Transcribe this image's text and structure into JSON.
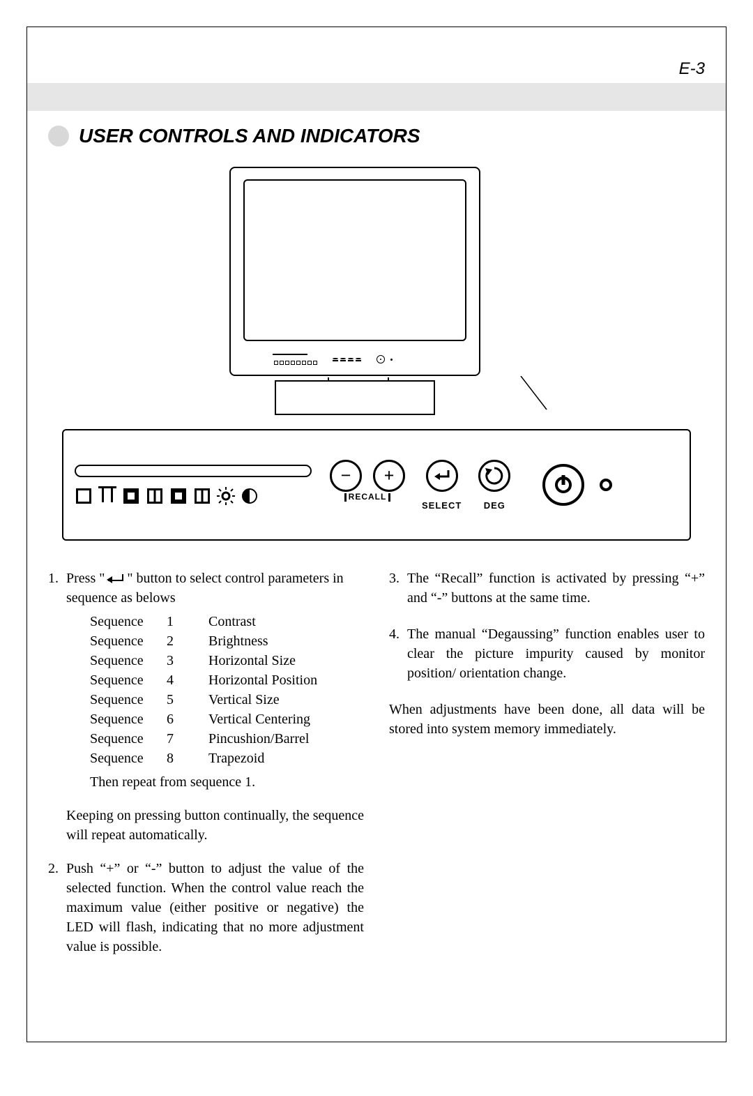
{
  "page_number": "E-3",
  "title": "USER CONTROLS AND INDICATORS",
  "panel": {
    "recall_label": "RECALL",
    "select_label": "SELECT",
    "deg_label": "DEG",
    "minus": "−",
    "plus": "+"
  },
  "icons": {
    "hsize": "h-size-icon",
    "vsize": "v-size-icon",
    "hpos": "h-pos-icon",
    "vpos": "v-pos-icon",
    "pincushion": "pincushion-icon",
    "trapezoid": "trapezoid-icon",
    "brightness": "brightness-icon",
    "contrast": "contrast-icon"
  },
  "left": {
    "item1_lead": "Press \" ",
    "item1_tail": " \" button to select control parameters in sequence as belows",
    "seq_label": "Sequence",
    "sequences": [
      {
        "n": "1",
        "name": "Contrast"
      },
      {
        "n": "2",
        "name": "Brightness"
      },
      {
        "n": "3",
        "name": "Horizontal Size"
      },
      {
        "n": "4",
        "name": "Horizontal Position"
      },
      {
        "n": "5",
        "name": "Vertical Size"
      },
      {
        "n": "6",
        "name": "Vertical Centering"
      },
      {
        "n": "7",
        "name": "Pincushion/Barrel"
      },
      {
        "n": "8",
        "name": "Trapezoid"
      }
    ],
    "then_repeat": "Then repeat from sequence 1.",
    "keeping": "Keeping on pressing button continually, the sequence will repeat automatically.",
    "item2": "Push “+” or “-” button to adjust the value of the selected function. When the control value reach the maximum value (either positive or negative) the LED will flash, indicating that no more adjustment value is possible."
  },
  "right": {
    "item3": "The “Recall” function is activated by pressing “+” and “-” buttons at the same time.",
    "item4": "The manual “Degaussing” function enables user to clear the picture impurity caused by monitor position/ orientation change.",
    "footer": "When adjustments have been done, all data will be stored into system memory immediately."
  },
  "numbers": {
    "n1": "1.",
    "n2": "2.",
    "n3": "3.",
    "n4": "4."
  }
}
